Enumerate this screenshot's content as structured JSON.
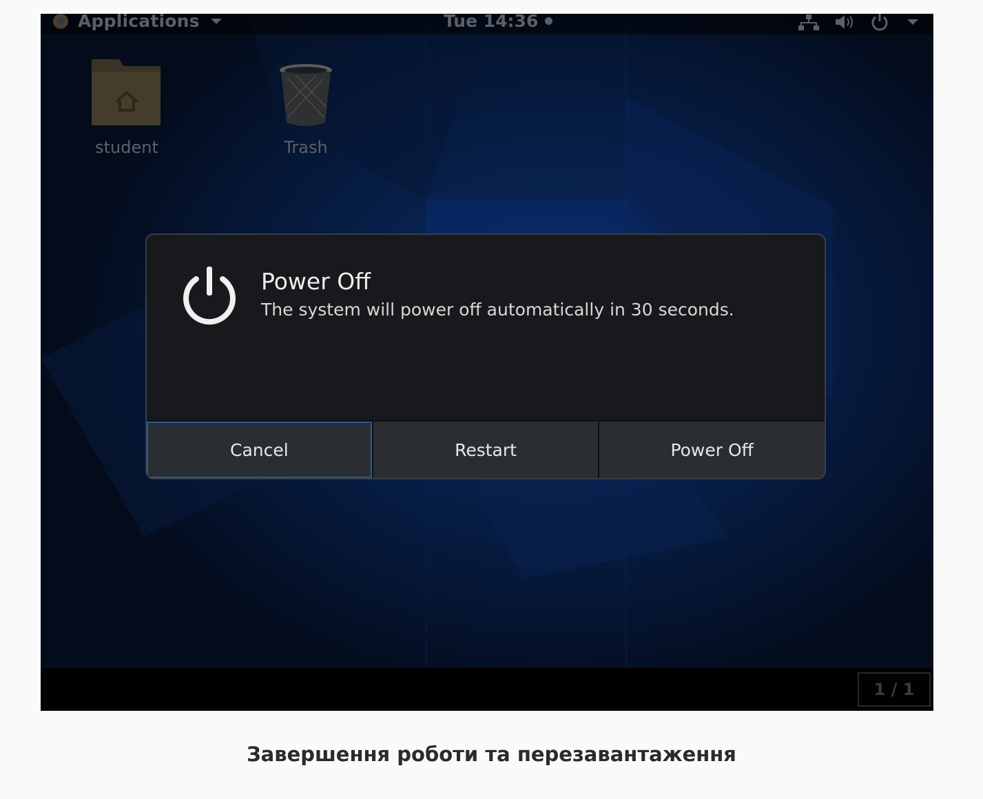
{
  "top_panel": {
    "applications_label": "Applications",
    "clock": "Tue 14:36"
  },
  "desktop": {
    "icons": [
      {
        "label": "student",
        "icon": "home-folder-icon"
      },
      {
        "label": "Trash",
        "icon": "trash-icon"
      }
    ]
  },
  "dialog": {
    "title": "Power Off",
    "message": "The system will power off automatically in 30 seconds.",
    "icon": "power-icon",
    "buttons": {
      "cancel": "Cancel",
      "restart": "Restart",
      "power_off": "Power Off"
    }
  },
  "bottom_panel": {
    "workspace_indicator": "1 / 1"
  },
  "caption": "Завершення роботи та перезавантаження",
  "colors": {
    "dialog_bg": "#17191c",
    "button_bg": "#2a2e33",
    "focus_accent": "#215d9c",
    "wallpaper": "#05122a"
  }
}
